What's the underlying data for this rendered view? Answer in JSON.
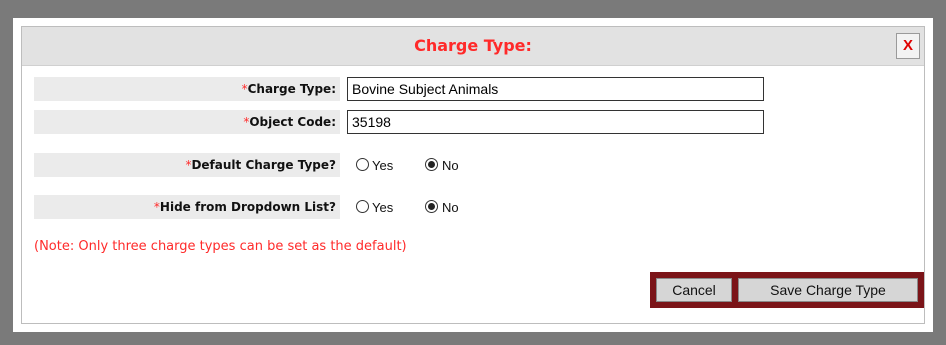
{
  "dialog": {
    "title": "Charge Type:",
    "close_label": "X"
  },
  "form": {
    "required_mark": "*",
    "charge_type": {
      "label": "Charge Type:",
      "value": "Bovine Subject Animals"
    },
    "object_code": {
      "label": "Object Code:",
      "value": "35198"
    },
    "default_charge_type": {
      "label": "Default Charge Type?",
      "options": [
        "Yes",
        "No"
      ],
      "selected": "No"
    },
    "hide_from_dropdown": {
      "label": "Hide from Dropdown List?",
      "options": [
        "Yes",
        "No"
      ],
      "selected": "No"
    },
    "note": "(Note: Only three charge types can be set as the default)"
  },
  "buttons": {
    "cancel_label": "Cancel",
    "save_label": "Save Charge Type"
  },
  "colors": {
    "accent_red": "#ff2a2a",
    "button_bar": "#7b1418",
    "label_bg": "#ebebeb"
  }
}
